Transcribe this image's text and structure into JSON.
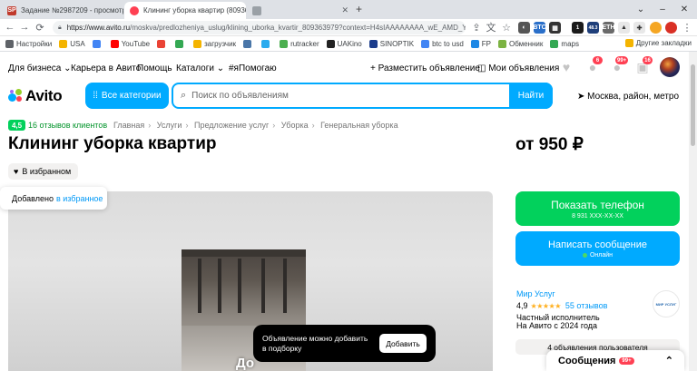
{
  "browser": {
    "tabs": [
      {
        "favicon": "SP",
        "favicon_color": "#c0392b",
        "title": "Задание №2987209 - просмотр з"
      },
      {
        "favicon": "",
        "favicon_color": "#ff4053",
        "title": "Клининг уборка квартир (809365"
      },
      {
        "favicon": "",
        "favicon_color": "#9aa0a6",
        "title": ""
      }
    ],
    "url_host": "https://www.avito.ru",
    "url_path": "/moskva/predlozheniya_uslug/klining_uborka_kvartir_809363979?context=H4sIAAAAAAAA_wE_AMD_YTo...",
    "extension_labels": [
      "BTC",
      "LTC",
      "ETH"
    ],
    "extension_values": [
      "1",
      "48.3"
    ]
  },
  "bookmarks": {
    "items": [
      "Настройки",
      "USA",
      "",
      "YouTube",
      "",
      "",
      "загрузчик",
      "",
      "",
      "rutracker",
      "UAKino",
      "SINOPTIK",
      "btc to usd",
      "FP",
      "Обменник",
      "maps"
    ],
    "other": "Другие закладки"
  },
  "topnav": {
    "for_business": "Для бизнеса",
    "career": "Карьера в Авито",
    "help": "Помощь",
    "catalogs": "Каталоги",
    "help_tag": "#яПомогаю",
    "post_ad": "Разместить объявление",
    "my_ads": "Мои объявления",
    "fav_badge": "6",
    "msg_badge": "99+",
    "cart_badge": "16"
  },
  "search": {
    "logo": "Avito",
    "all_categories": "Все категории",
    "placeholder": "Поиск по объявлениям",
    "button": "Найти",
    "location": "Москва, район, метро"
  },
  "listing": {
    "rating": "4,5",
    "reviews_link": "16 отзывов клиентов",
    "breadcrumb": [
      "Главная",
      "Услуги",
      "Предложение услуг",
      "Уборка",
      "Генеральная уборка"
    ],
    "title": "Клининг уборка квартир",
    "price": "от 950 ₽",
    "favorite_button": "В избранном",
    "tooltip_text": "Добавлено",
    "tooltip_link": "в избранное",
    "photo_caption": "До"
  },
  "toast": {
    "text": "Объявление можно добавить в подборку",
    "button": "Добавить"
  },
  "contact": {
    "phone_button": "Показать телефон",
    "phone_masked": "8 931 XXX-XX-XX",
    "message_button": "Написать сообщение",
    "status": "Онлайн"
  },
  "seller": {
    "name": "Мир Услуг",
    "rating": "4,9",
    "stars": "★★★★★",
    "reviews": "55 отзывов",
    "type": "Частный исполнитель",
    "since": "На Авито с 2024 года",
    "logo_text": "МИР УСЛУГ",
    "ads_count": "4 объявления пользователя"
  },
  "messages": {
    "label": "Сообщения",
    "badge": "99+"
  },
  "colors": {
    "accent_blue": "#00aaff",
    "accent_green": "#02d15c",
    "badge_red": "#ff4053",
    "link_blue": "#0099f7"
  }
}
